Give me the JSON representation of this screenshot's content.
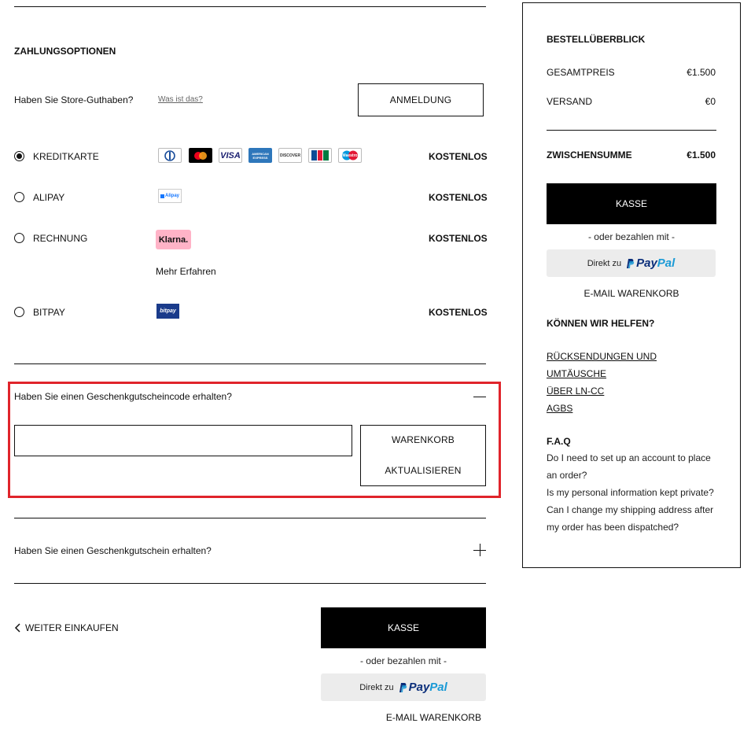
{
  "payment": {
    "heading": "ZAHLUNGSOPTIONEN",
    "store_credit_question": "Haben Sie Store-Guthaben?",
    "what_is_link": "Was ist das?",
    "login_button": "ANMELDUNG",
    "free_label": "KOSTENLOS",
    "options": [
      {
        "label": "KREDITKARTE",
        "selected": true
      },
      {
        "label": "ALIPAY",
        "selected": false
      },
      {
        "label": "RECHNUNG",
        "selected": false
      },
      {
        "label": "BITPAY",
        "selected": false
      }
    ],
    "card_icons": [
      "diners-club",
      "mastercard",
      "visa",
      "american-express",
      "discover",
      "jcb",
      "maestro"
    ],
    "card_texts": {
      "visa": "VISA",
      "amex": "AMERICAN EXPRESS",
      "discover": "DISCOVER",
      "jcb": "JCB",
      "maestro": "Maestro"
    },
    "alipay_badge": "Alipay",
    "klarna_badge": "Klarna.",
    "learn_more": "Mehr Erfahren",
    "bitpay_badge": "bitpay"
  },
  "gift_code": {
    "question": "Haben Sie einen Geschenkgutscheincode erhalten?",
    "input_value": "",
    "update_button_line1": "WARENKORB",
    "update_button_line2": "AKTUALISIEREN",
    "highlight_color": "#e0242b"
  },
  "gift_card": {
    "question": "Haben Sie einen Geschenkgutschein erhalten?"
  },
  "bottom": {
    "continue_shopping": "WEITER EINKAUFEN",
    "checkout_button": "KASSE",
    "or_pay_with": "- oder bezahlen mit -",
    "paypal_prefix": "Direkt zu",
    "paypal_pay": "Pay",
    "paypal_pal": "Pal",
    "email_cart": "E-MAIL WARENKORB"
  },
  "summary": {
    "heading": "BESTELLÜBERBLICK",
    "total_label": "GESAMTPREIS",
    "total_value": "€1.500",
    "shipping_label": "VERSAND",
    "shipping_value": "€0",
    "subtotal_label": "ZWISCHENSUMME",
    "subtotal_value": "€1.500",
    "checkout_button": "KASSE",
    "or_pay_with": "- oder bezahlen mit -",
    "paypal_prefix": "Direkt zu",
    "paypal_pay": "Pay",
    "paypal_pal": "Pal",
    "email_cart": "E-MAIL WARENKORB",
    "help_heading": "KÖNNEN WIR HELFEN?",
    "help_links": [
      "RÜCKSENDUNGEN UND",
      "UMTÄUSCHE",
      "ÜBER LN-CC",
      "AGBS"
    ],
    "faq_heading": "F.A.Q",
    "faq_lines": [
      "Do I need to set up an account to place",
      "an order?",
      "Is my personal information kept private?",
      "Can I change my shipping address after",
      "my order has been dispatched?"
    ]
  }
}
